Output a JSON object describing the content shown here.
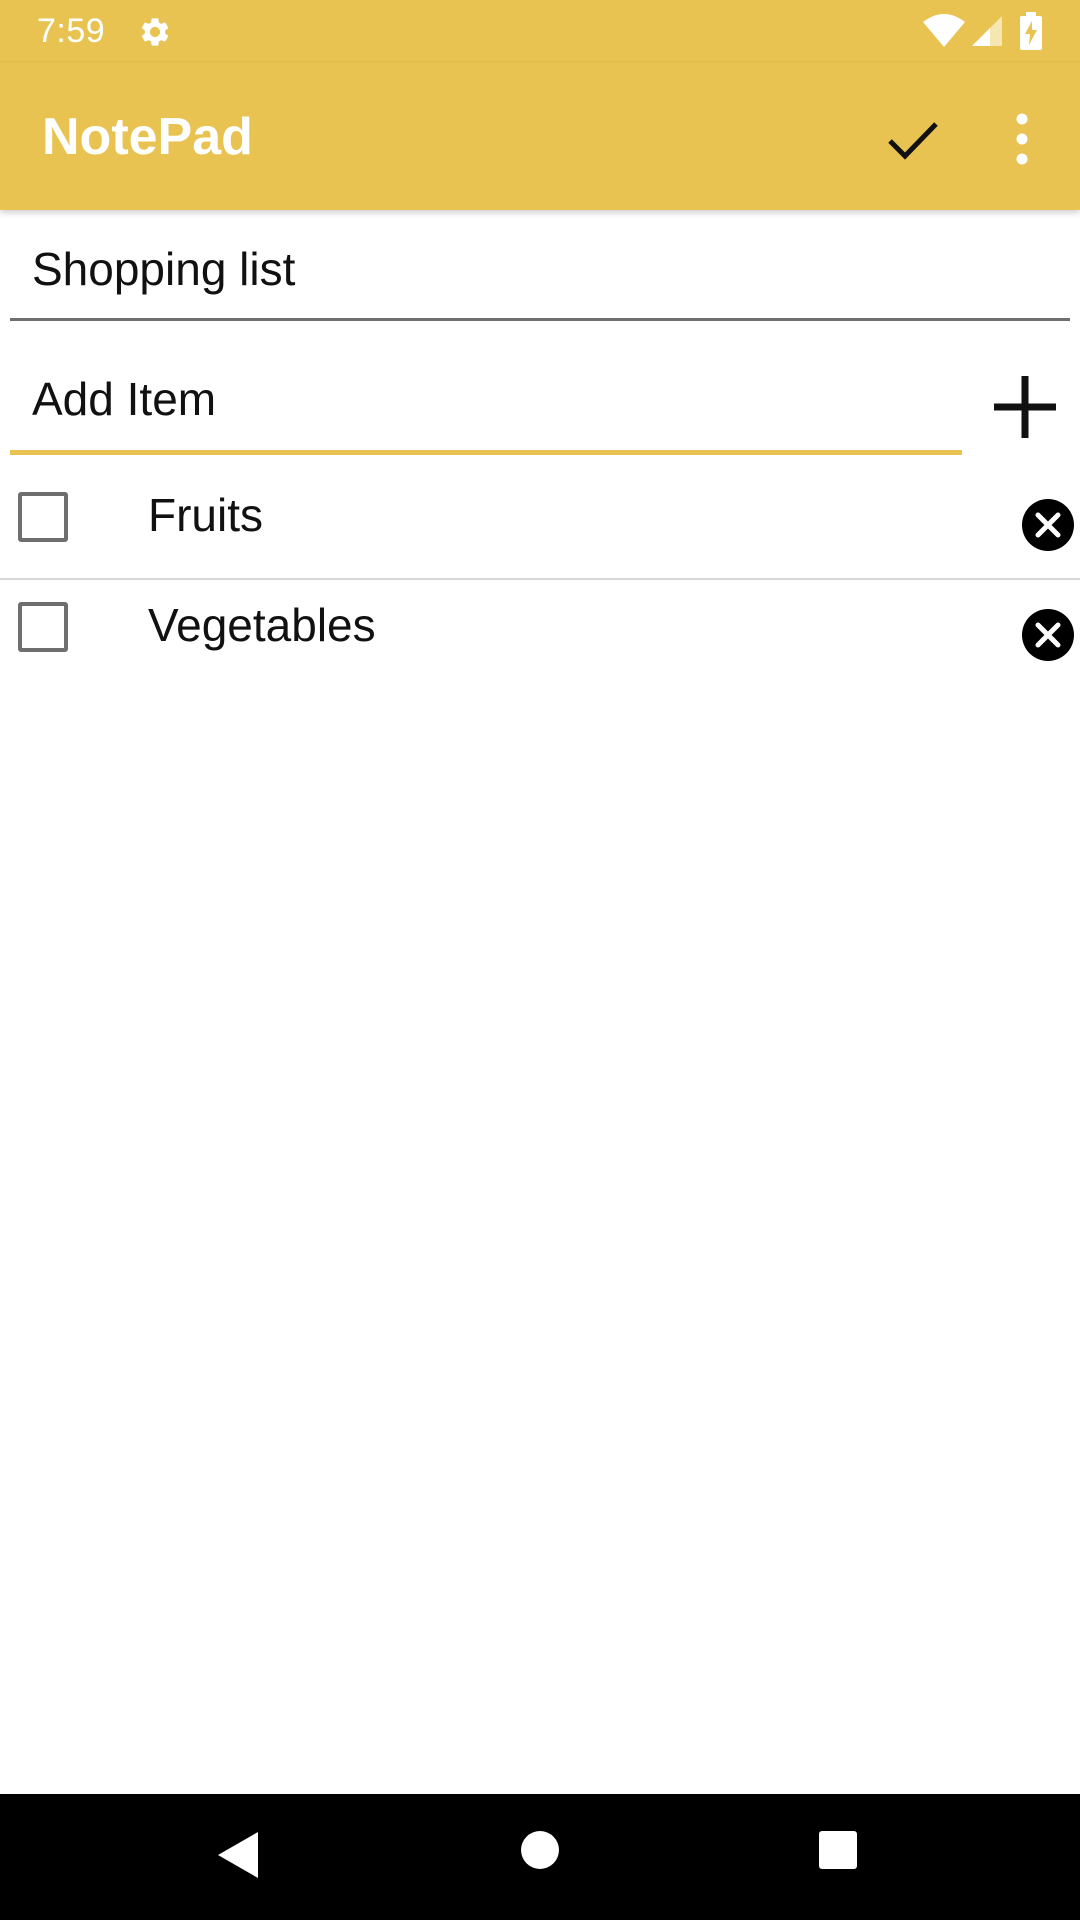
{
  "status_bar": {
    "time": "7:59",
    "icons": [
      "gear-icon",
      "wifi-icon",
      "signal-icon",
      "battery-charging-icon"
    ]
  },
  "app_bar": {
    "title": "NotePad",
    "actions": [
      "check-icon",
      "more-vert-icon"
    ],
    "color": "#e8c352"
  },
  "note": {
    "title": "Shopping list"
  },
  "add_item": {
    "placeholder": "Add Item",
    "button_icon": "plus-icon",
    "accent": "#e8c352"
  },
  "items": [
    {
      "label": "Fruits",
      "checked": false
    },
    {
      "label": "Vegetables",
      "checked": false
    }
  ],
  "nav_bar": {
    "buttons": [
      "back-icon",
      "home-icon",
      "recents-icon"
    ]
  }
}
